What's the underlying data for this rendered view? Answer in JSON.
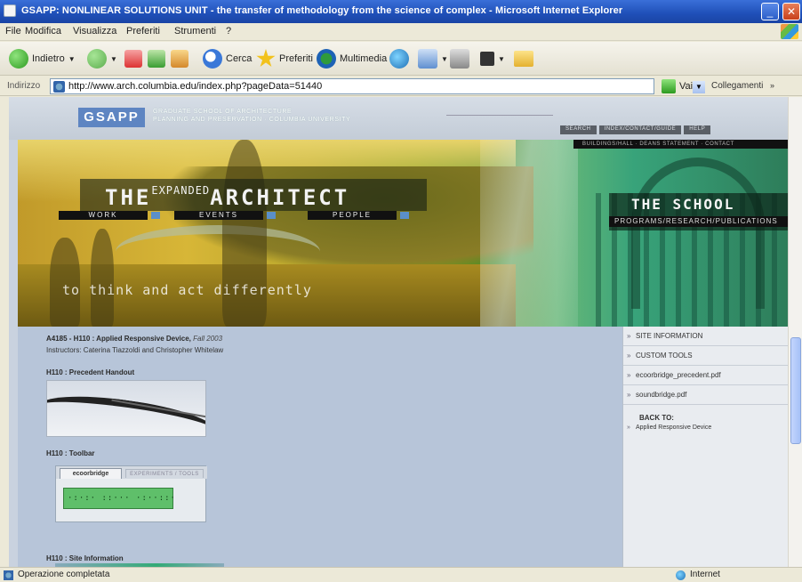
{
  "window": {
    "title": "GSAPP: NONLINEAR SOLUTIONS UNIT - the transfer of methodology from the science of complex - Microsoft Internet Explorer",
    "minimize_glyph": "_",
    "close_glyph": "✕"
  },
  "menu": [
    "File",
    "Modifica",
    "Visualizza",
    "Preferiti",
    "Strumenti",
    "?"
  ],
  "toolbar": {
    "back_label": "Indietro",
    "search_label": "Cerca",
    "favorites_label": "Preferiti",
    "media_label": "Multimedia"
  },
  "address": {
    "label": "Indirizzo",
    "url": "http://www.arch.columbia.edu/index.php?pageData=51440",
    "go_label": "Vai",
    "links_label": "Collegamenti"
  },
  "site": {
    "logo": "GSAPP",
    "logo_tagline_1": "GRADUATE SCHOOL OF ARCHITECTURE",
    "logo_tagline_2": "PLANNING AND PRESERVATION · COLUMBIA UNIVERSITY",
    "util_nav": [
      "SEARCH",
      "INDEX/CONTACT/GUIDE",
      "HELP"
    ],
    "mini_nav": "BUILDINGS/HALL · DEANS STATEMENT · CONTACT"
  },
  "banner": {
    "headline_pre": "THE",
    "headline_sup": "EXPANDED",
    "headline_post": "ARCHITECT",
    "nav": [
      "WORK",
      "EVENTS",
      "PEOPLE"
    ],
    "school_title": "THE SCHOOL",
    "school_sub": "PROGRAMS/RESEARCH/PUBLICATIONS",
    "tagline": "to think and act differently"
  },
  "content": {
    "course": "A4185 - H110 : Applied Responsive Device,",
    "semester": "Fall 2003",
    "instructors": "Instructors: Caterina Tiazzoldi and Christopher Whitelaw",
    "section_1": "H110 : Precedent Handout",
    "section_2": "H110 : Toolbar",
    "toolbar_tab_a": "ecoorbridge",
    "toolbar_tab_b": "EXPERIMENTS / TOOLS",
    "toolbar_glyphs": "·:·:· ::··· ·:··::·",
    "section_3": "H110 : Site Information"
  },
  "sidebar": {
    "items": [
      "SITE INFORMATION",
      "CUSTOM TOOLS",
      "ecoorbridge_precedent.pdf",
      "soundbridge.pdf"
    ],
    "back_heading": "BACK TO:",
    "back_link": "Applied Responsive Device"
  },
  "status": {
    "text": "Operazione completata",
    "zone": "Internet"
  }
}
